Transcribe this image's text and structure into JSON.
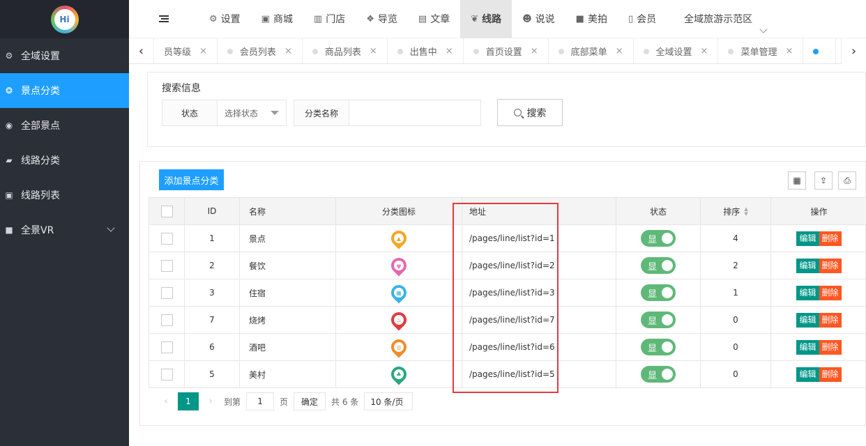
{
  "sidebar": {
    "logo_text": "Hi",
    "items": [
      {
        "label": "全域设置",
        "icon": "gear-icon",
        "glyph": "⚙"
      },
      {
        "label": "景点分类",
        "icon": "rebel-icon",
        "glyph": "❂"
      },
      {
        "label": "全部景点",
        "icon": "globe-icon",
        "glyph": "◉"
      },
      {
        "label": "线路分类",
        "icon": "eraser-icon",
        "glyph": "▰"
      },
      {
        "label": "线路列表",
        "icon": "cc-icon",
        "glyph": "▣"
      },
      {
        "label": "全景VR",
        "icon": "video-icon",
        "glyph": "■"
      }
    ]
  },
  "topnav": {
    "items": [
      {
        "label": "设置",
        "icon": "gears-icon",
        "glyph": "⚙"
      },
      {
        "label": "商城",
        "icon": "shopping-bag-icon",
        "glyph": "▣"
      },
      {
        "label": "门店",
        "icon": "bank-icon",
        "glyph": "▥"
      },
      {
        "label": "导览",
        "icon": "cubes-icon",
        "glyph": "❖"
      },
      {
        "label": "文章",
        "icon": "newspaper-icon",
        "glyph": "▤"
      },
      {
        "label": "线路",
        "icon": "pagelines-icon",
        "glyph": "❦"
      },
      {
        "label": "说说",
        "icon": "wechat-icon",
        "glyph": "☻"
      },
      {
        "label": "美拍",
        "icon": "video-camera-icon",
        "glyph": "■"
      },
      {
        "label": "会员",
        "icon": "trash-icon",
        "glyph": "▯"
      }
    ],
    "right_label": "全域旅游示范区"
  },
  "tabs": {
    "items": [
      {
        "label": "员等级"
      },
      {
        "label": "会员列表"
      },
      {
        "label": "商品列表"
      },
      {
        "label": "出售中"
      },
      {
        "label": "首页设置"
      },
      {
        "label": "底部菜单"
      },
      {
        "label": "全域设置"
      },
      {
        "label": "菜单管理"
      },
      {
        "label": ""
      }
    ],
    "close_glyph": "×"
  },
  "search": {
    "legend": "搜索信息",
    "status_label": "状态",
    "status_value": "选择状态",
    "category_label": "分类名称",
    "button_label": "搜索"
  },
  "toolbar": {
    "add_label": "添加景点分类"
  },
  "table": {
    "headers": {
      "id": "ID",
      "name": "名称",
      "icon": "分类图标",
      "url": "地址",
      "status": "状态",
      "sort": "排序",
      "op": "操作"
    },
    "status_label": "显",
    "edit_label": "编辑",
    "delete_label": "删除",
    "rows": [
      {
        "id": "1",
        "name": "景点",
        "url": "/pages/line/list?id=1",
        "sort": "4",
        "icon_color": "#f5a623",
        "icon_glyph": "▲"
      },
      {
        "id": "2",
        "name": "餐饮",
        "url": "/pages/line/list?id=2",
        "sort": "2",
        "icon_color": "#e667b0",
        "icon_glyph": "ψ"
      },
      {
        "id": "3",
        "name": "住宿",
        "url": "/pages/line/list?id=3",
        "sort": "1",
        "icon_color": "#3ab3e5",
        "icon_glyph": "▦"
      },
      {
        "id": "7",
        "name": "烧烤",
        "url": "/pages/line/list?id=7",
        "sort": "0",
        "icon_color": "#e4393c",
        "icon_glyph": "♨"
      },
      {
        "id": "6",
        "name": "酒吧",
        "url": "/pages/line/list?id=6",
        "sort": "0",
        "icon_color": "#f08c2c",
        "icon_glyph": "◎"
      },
      {
        "id": "5",
        "name": "美村",
        "url": "/pages/line/list?id=5",
        "sort": "0",
        "icon_color": "#2aa87a",
        "icon_glyph": "♣"
      }
    ]
  },
  "pager": {
    "current": "1",
    "goto_label": "到第",
    "goto_value": "1",
    "page_label": "页",
    "confirm_label": "确定",
    "total_label": "共 6 条",
    "size_label": "10 条/页"
  },
  "colors": {
    "sidebar_bg": "#2a2f38",
    "accent": "#1e9fff",
    "teal": "#009688",
    "danger": "#ff5722",
    "toggle_on": "#5fb878",
    "highlight_box": "#e4393c"
  }
}
